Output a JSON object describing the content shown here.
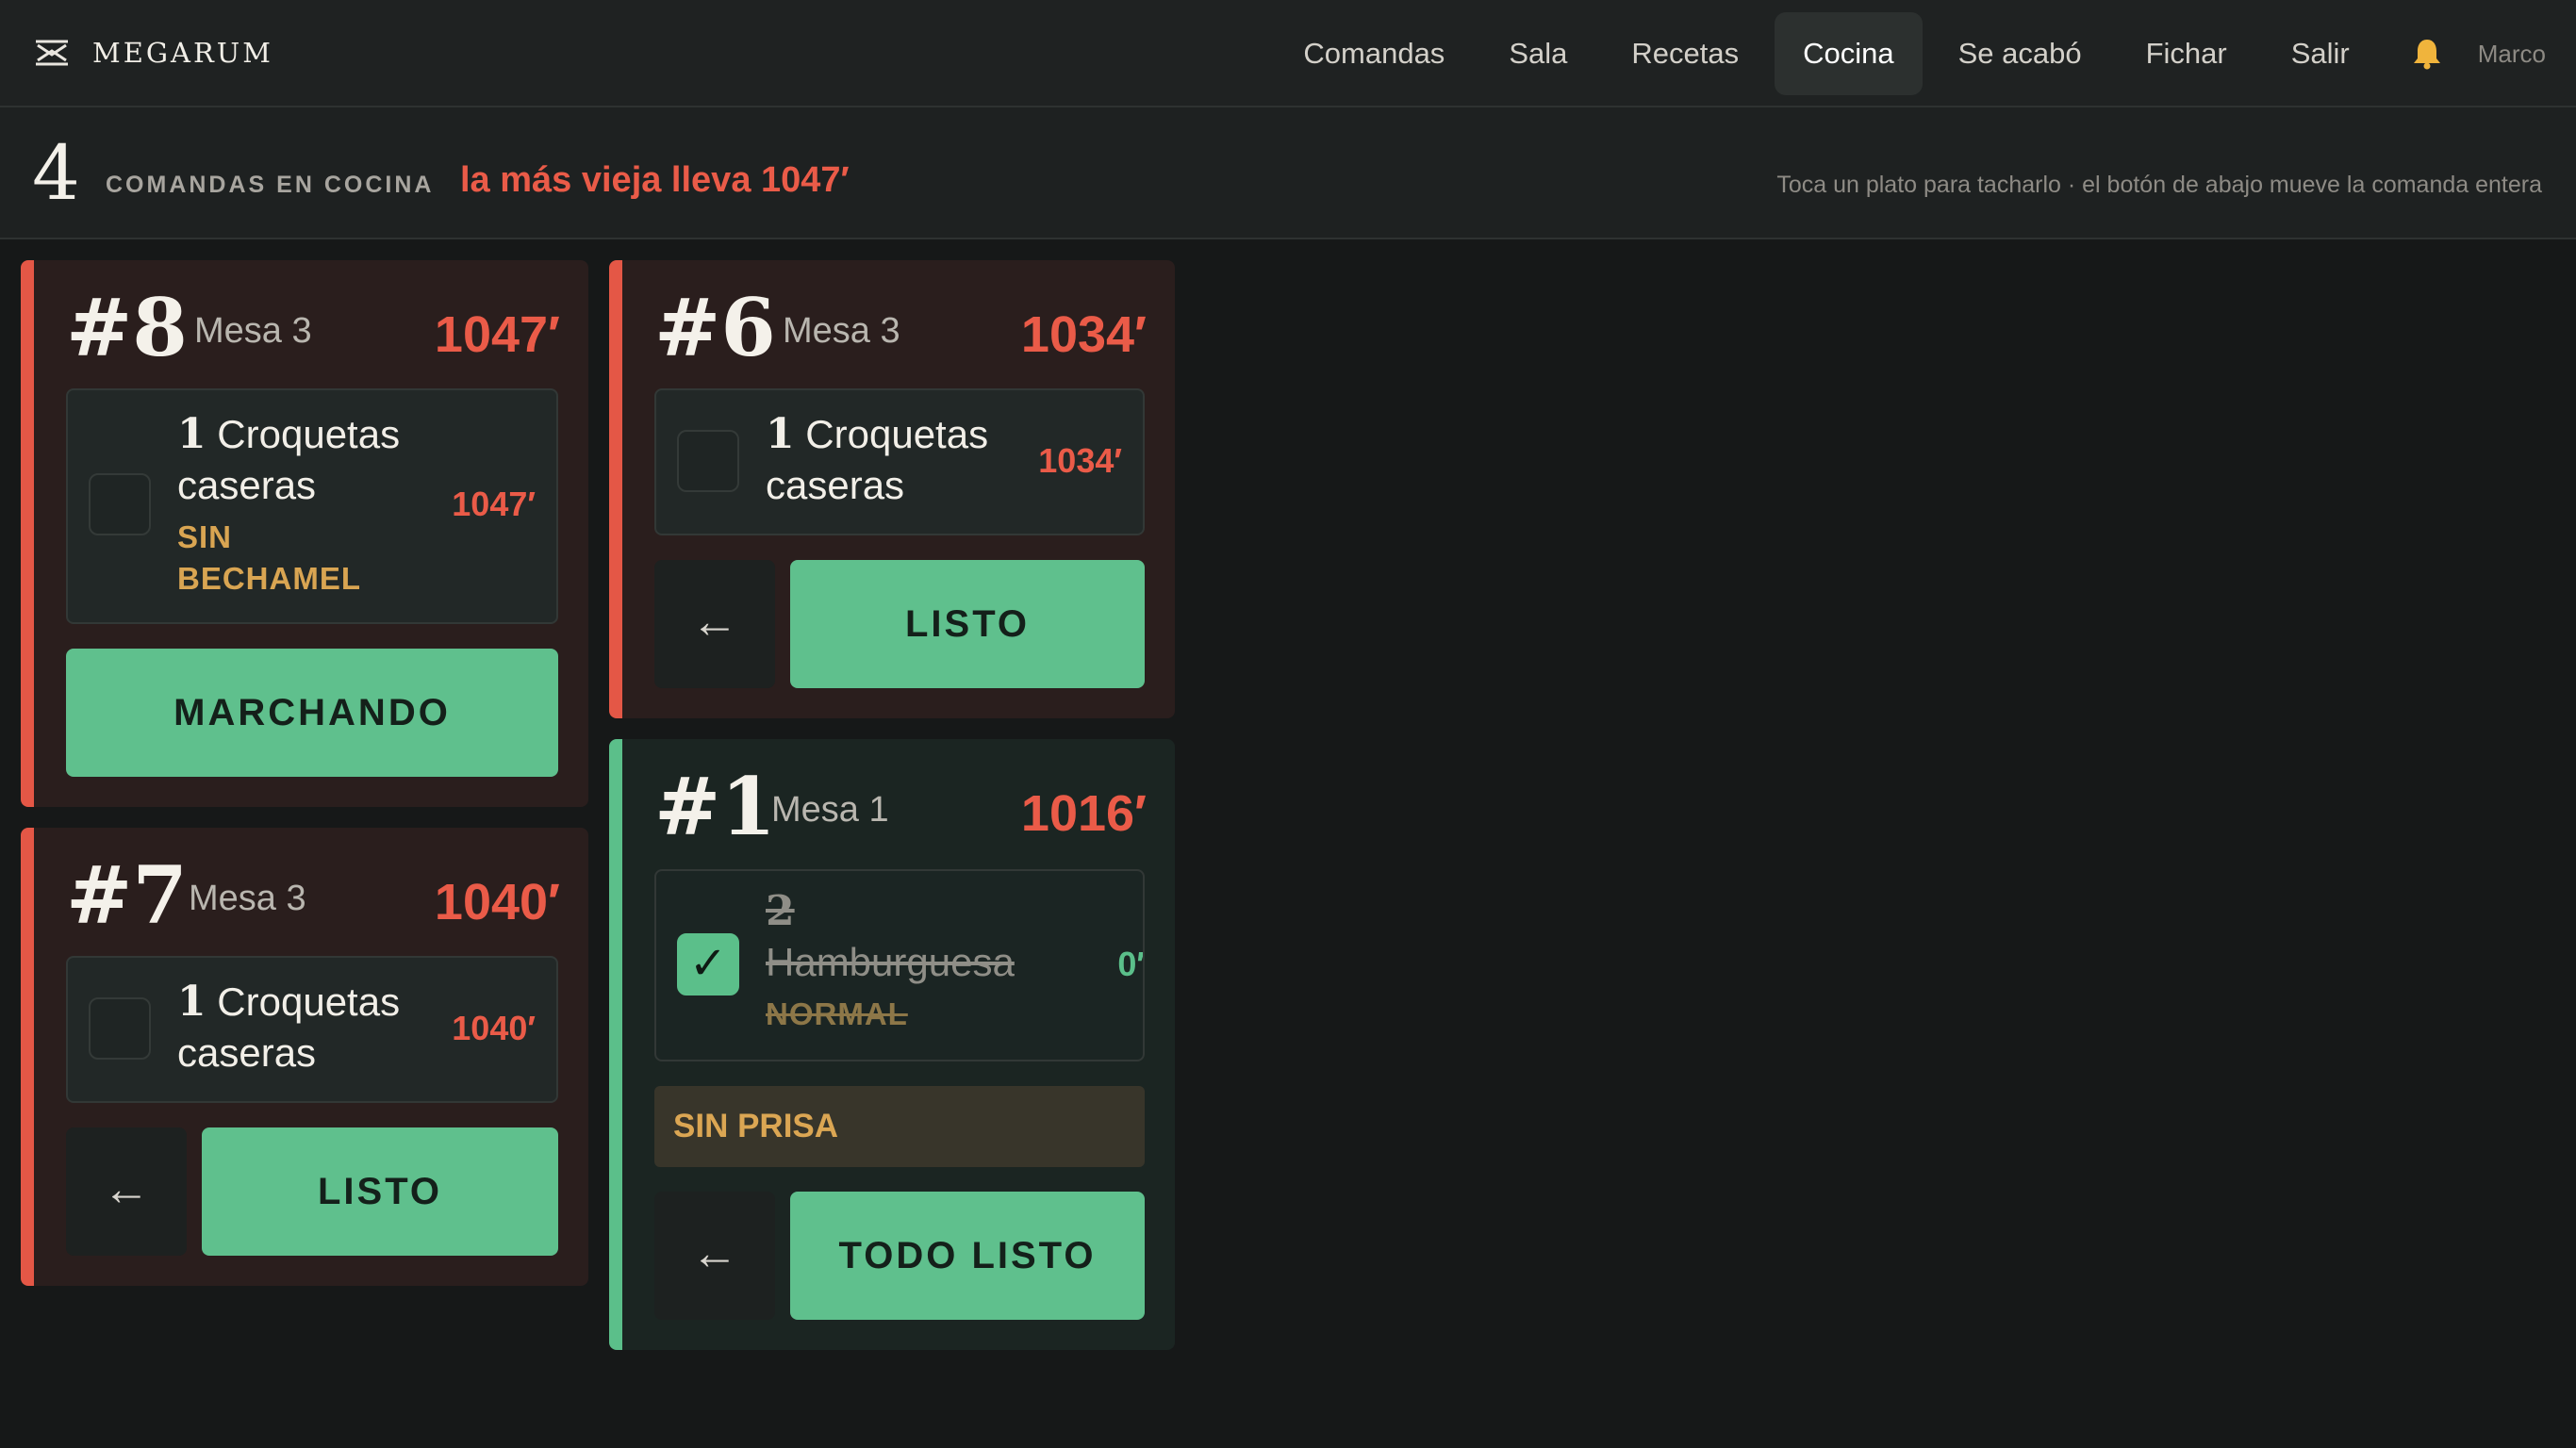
{
  "app": {
    "brand": "MEGARUM",
    "brand_icon": "megarum-logo-icon"
  },
  "nav": {
    "items": [
      "Comandas",
      "Sala",
      "Recetas",
      "Cocina",
      "Se acabó",
      "Fichar",
      "Salir"
    ],
    "active": "Cocina",
    "bell_icon": "bell-icon",
    "user": "Marco"
  },
  "summary": {
    "count": "4",
    "label": "COMANDAS EN COCINA",
    "oldest": "la más vieja lleva 1047′",
    "hint": "Toca un plato para tacharlo · el botón de abajo mueve la comanda entera"
  },
  "tickets": [
    {
      "number": "#8",
      "table": "Mesa 3",
      "elapsed": "1047′",
      "status": "late",
      "items": [
        {
          "qty": "1",
          "name_line1": "Croquetas",
          "name_line2": "caseras",
          "modifier_line1": "SIN",
          "modifier_line2": "BECHAMEL",
          "elapsed": "1047′",
          "done": false
        }
      ],
      "action": "MARCHANDO"
    },
    {
      "number": "#7",
      "table": "Mesa 3",
      "elapsed": "1040′",
      "status": "late",
      "items": [
        {
          "qty": "1",
          "name_line1": "Croquetas",
          "name_line2": "caseras",
          "elapsed": "1040′",
          "done": false
        }
      ],
      "back": "←",
      "action": "LISTO"
    },
    {
      "number": "#6",
      "table": "Mesa 3",
      "elapsed": "1034′",
      "status": "late",
      "items": [
        {
          "qty": "1",
          "name_line1": "Croquetas",
          "name_line2": "caseras",
          "elapsed": "1034′",
          "done": false
        }
      ],
      "back": "←",
      "action": "LISTO"
    },
    {
      "number": "#1",
      "table": "Mesa 1",
      "elapsed": "1016′",
      "status": "ok",
      "items": [
        {
          "qty": "2",
          "name_line1": "Hamburguesa",
          "modifier_line1": "NORMAL",
          "elapsed": "0′",
          "done": true,
          "check": "✓"
        }
      ],
      "note": "SIN PRISA",
      "back": "←",
      "action": "TODO LISTO"
    }
  ],
  "colors": {
    "late": "#e45746",
    "ok": "#5bbf8a",
    "modifier": "#d9a552",
    "button": "#5fc08d"
  }
}
